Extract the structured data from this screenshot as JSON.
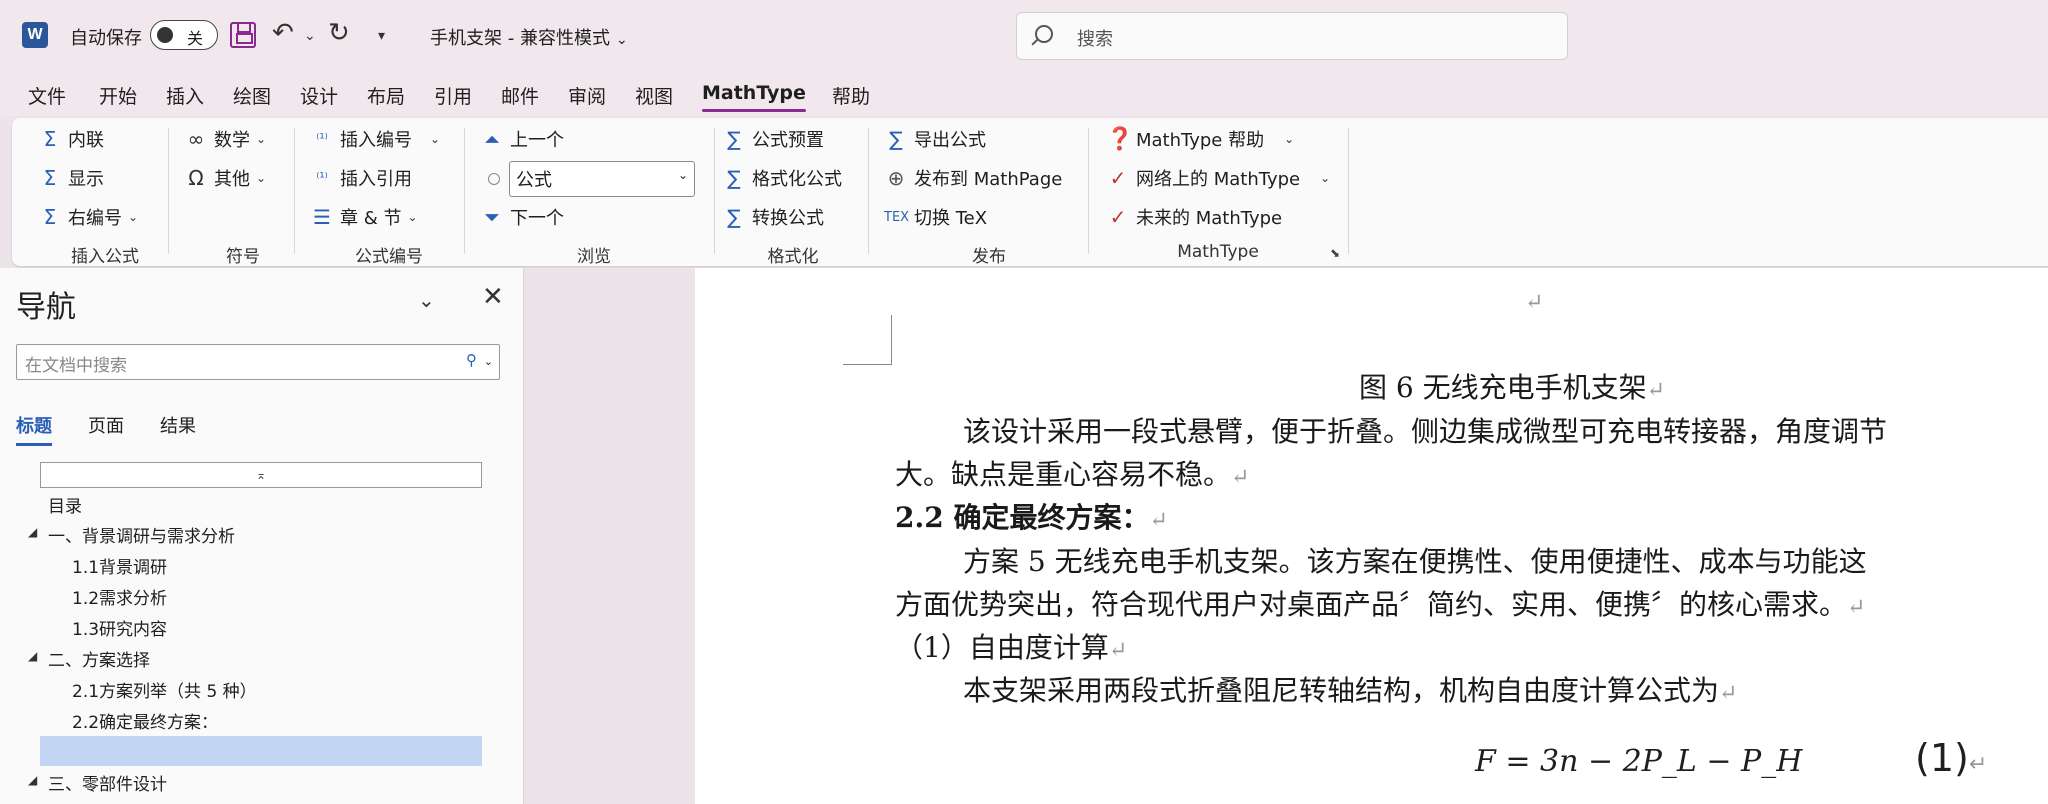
{
  "titlebar": {
    "app_logo": "W",
    "autosave_label": "自动保存",
    "autosave_state": "关",
    "doc_title": "手机支架 - 兼容性模式",
    "search_placeholder": "搜索"
  },
  "menu_tabs": [
    "文件",
    "开始",
    "插入",
    "绘图",
    "设计",
    "布局",
    "引用",
    "邮件",
    "审阅",
    "视图",
    "MathType",
    "帮助"
  ],
  "active_tab": "MathType",
  "ribbon": {
    "insert_formula": {
      "inline": "内联",
      "display": "显示",
      "right_numbered": "右编号",
      "label": "插入公式"
    },
    "symbols": {
      "math": "数学",
      "other": "其他",
      "label": "符号"
    },
    "formula_numbers": {
      "insert_number": "插入编号",
      "insert_reference": "插入引用",
      "chapter_section": "章 & 节",
      "label": "公式编号"
    },
    "browse": {
      "previous": "上一个",
      "select_value": "公式",
      "next": "下一个",
      "label": "浏览"
    },
    "format": {
      "presets": "公式预置",
      "format_formula": "格式化公式",
      "convert": "转换公式",
      "label": "格式化"
    },
    "publish": {
      "export": "导出公式",
      "publish_mathpage": "发布到 MathPage",
      "toggle_tex": "切换 TeX",
      "label": "发布"
    },
    "mathtype": {
      "help": "MathType 帮助",
      "online": "网络上的 MathType",
      "future": "未来的 MathType",
      "label": "MathType"
    }
  },
  "nav": {
    "title": "导航",
    "search_placeholder": "在文档中搜索",
    "tabs": [
      "标题",
      "页面",
      "结果"
    ],
    "items": [
      {
        "text": "目录",
        "level": 1,
        "expander": false
      },
      {
        "text": "一、背景调研与需求分析",
        "level": 1,
        "expander": true
      },
      {
        "text": "1.1背景调研",
        "level": 2,
        "expander": false
      },
      {
        "text": "1.2需求分析",
        "level": 2,
        "expander": false
      },
      {
        "text": "1.3研究内容",
        "level": 2,
        "expander": false
      },
      {
        "text": "二、方案选择",
        "level": 1,
        "expander": true
      },
      {
        "text": "2.1方案列举（共 5 种）",
        "level": 2,
        "expander": false
      },
      {
        "text": "2.2确定最终方案：",
        "level": 2,
        "expander": false
      },
      {
        "text": "",
        "level": 2,
        "expander": false
      },
      {
        "text": "三、零部件设计",
        "level": 1,
        "expander": true
      }
    ]
  },
  "document": {
    "caption": "图 6  无线充电手机支架",
    "para1_line1": "该设计采用一段式悬臂，便于折叠。侧边集成微型可充电转接器，角度调节",
    "para1_line2": "大。缺点是重心容易不稳。",
    "heading": "2.2 确定最终方案：",
    "para2_line1": "方案 5 无线充电手机支架。该方案在便携性、使用便捷性、成本与功能这",
    "para2_line2": "方面优势突出，符合现代用户对桌面产品〞简约、实用、便携〞的核心需求。",
    "sub_heading": "（1）自由度计算",
    "para3": "本支架采用两段式折叠阻尼转轴结构，机构自由度计算公式为",
    "formula": "F = 3n − 2P_L − P_H",
    "equation_number": "(1)",
    "paragraph_mark": "↵"
  },
  "colors": {
    "accent": "#8a2a8f",
    "blue": "#2b5fb5",
    "word_blue": "#2b579a"
  }
}
